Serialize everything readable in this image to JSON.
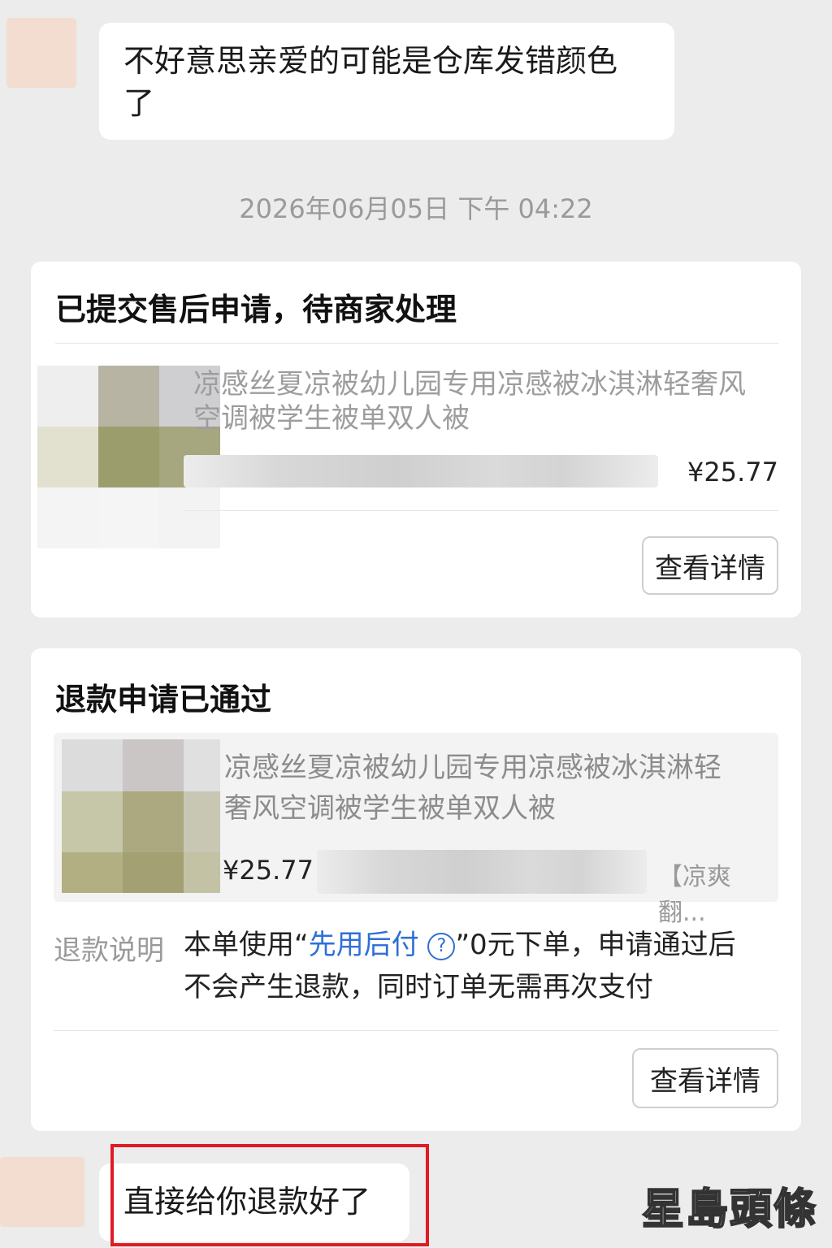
{
  "messages": {
    "first_line1": "不好意思亲爱的可能是仓库发错颜色",
    "first_line2": "了",
    "last": "直接给你退款好了"
  },
  "timestamp": "2026年06月05日 下午 04:22",
  "card1": {
    "title": "已提交售后申请，待商家处理",
    "product_line1": "凉感丝夏凉被幼儿园专用凉感被冰淇淋轻奢风",
    "product_line2": "空调被学生被单双人被",
    "price": "¥25.77",
    "button": "查看详情"
  },
  "card2": {
    "title": "退款申请已通过",
    "product_line1": "凉感丝夏凉被幼儿园专用凉感被冰淇淋轻",
    "product_line2": "奢风空调被学生被单双人被",
    "price": "¥25.77",
    "sku": "【凉爽翻...",
    "refund_label": "退款说明",
    "refund_prefix": "本单使用“",
    "refund_link": "先用后付",
    "refund_q": "?",
    "refund_suffix": "”0元下单，申请通过后",
    "refund_line2": "不会产生退款，同时订单无需再次支付",
    "button": "查看详情"
  },
  "watermark": "星島頭條",
  "colors": {
    "link": "#2f6fd6",
    "highlight_box": "#e01b24",
    "background": "#ececec"
  }
}
